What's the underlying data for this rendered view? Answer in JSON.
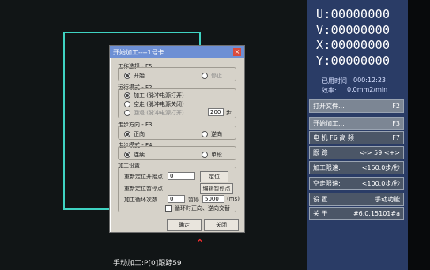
{
  "status_text": "手动加工:P[0]跟踪59",
  "coords": [
    "U:00000000",
    "V:00000000",
    "X:00000000",
    "Y:00000000"
  ],
  "info": {
    "time_label": "已用时间",
    "time_value": "000:12:23",
    "eff_label": "效率:",
    "eff_value": "0.0mm2/min"
  },
  "menu": [
    {
      "label": "打开文件...",
      "key": "F2"
    },
    {
      "label": "开始加工...",
      "key": "F3"
    },
    {
      "label": "电 机   F6 高 频",
      "key": "F7"
    },
    {
      "label": "跟 踪",
      "key": "<-> 59 <+>"
    },
    {
      "label": "加工限速:",
      "key": "<150.0步/秒"
    },
    {
      "label": "空走限速:",
      "key": "<100.0步/秒"
    },
    {
      "label": "设 置",
      "key": "手动功能"
    },
    {
      "label": "关 于",
      "key": "#6.0.15101#a"
    }
  ],
  "dialog": {
    "title": "开始加工----1号卡",
    "close": "×",
    "work_select_title": "工作选择 - F5",
    "work_start": "开始",
    "work_stop": "停止",
    "run_mode_title": "运行模式 - F2",
    "run_mode_1": "加工",
    "run_mode_1_note": "(脉冲电源打开)",
    "run_mode_2": "空走",
    "run_mode_2_note": "(脉冲电源关闭)",
    "run_mode_3": "回退",
    "run_mode_3_note": "(脉冲电源打开)",
    "step_value": "200",
    "step_unit": "步",
    "step_dir_title": "走步方向 - F3",
    "dir_forward": "正向",
    "dir_reverse": "逆向",
    "step_mode_title": "走步模式 - F4",
    "mode_continuous": "连续",
    "mode_single": "单段",
    "setting_title": "加工设置",
    "redef_start_label": "重新定位开始点",
    "redef_start_value": "0",
    "redef_start_btn": "定位",
    "redef_pause_label": "重新定位暂停点",
    "redef_pause_btn": "编辑暂停点",
    "loop_label": "加工循环次数",
    "loop_value": "0",
    "pause_label": "暂停",
    "pause_value": "5000",
    "pause_unit": "(ms)",
    "loop_reverse_label": "循环时正向、逆向交替",
    "ok": "确定",
    "cancel": "关闭"
  }
}
